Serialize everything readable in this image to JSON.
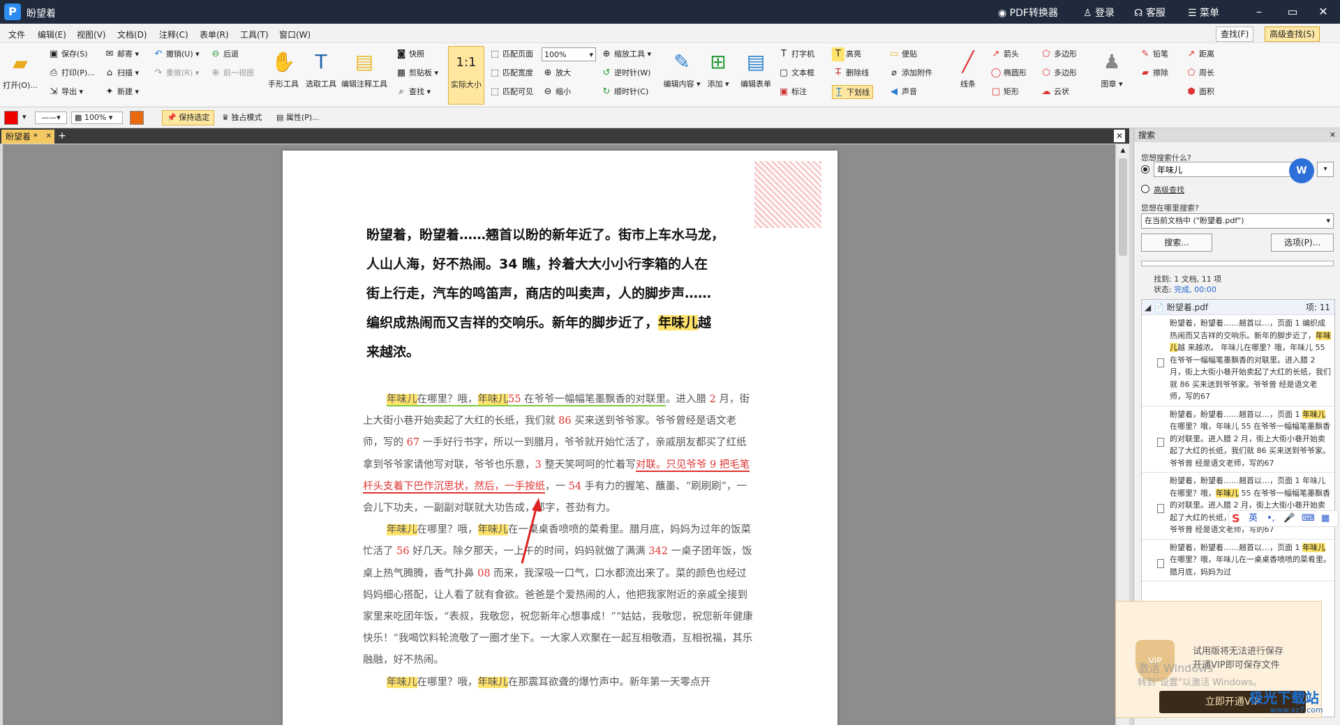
{
  "app": {
    "title": "盼望着",
    "pdf_converter": "PDF转换器",
    "login": "登录",
    "service": "客服",
    "menu": "菜单",
    "minimize": "–",
    "maximize": "▭",
    "close": "✕"
  },
  "menus": [
    "文件",
    "编辑(E)",
    "视图(V)",
    "文档(D)",
    "注释(C)",
    "表单(R)",
    "工具(T)",
    "窗口(W)"
  ],
  "menu_right": {
    "find": "查找(F)",
    "advanced_find": "高级查找(S)"
  },
  "ribbon": {
    "open": "打开(O)...",
    "save": "保存(S)",
    "mail": "邮寄",
    "undo": "撤销(U)",
    "back": "后退",
    "print": "打印(P)...",
    "scan": "扫描",
    "redo": "重做(R)",
    "prev_view": "前一视图",
    "export": "导出",
    "new": "新建",
    "hand": "手形工具",
    "select": "选取工具",
    "edit_annot": "编辑注释工具",
    "snapshot": "快照",
    "clipboard": "剪贴板",
    "search": "查找",
    "actual_size": "实际大小",
    "fit_page": "匹配页面",
    "fit_width": "匹配宽度",
    "fit_visible": "匹配可见",
    "zoom_value": "100%",
    "zoom_tool": "缩放工具",
    "zoom_in": "放大",
    "zoom_out": "缩小",
    "rotate_ccw": "逆时针(W)",
    "rotate_cw": "顺时针(C)",
    "edit_content": "编辑内容",
    "add": "添加",
    "edit_form": "编辑表单",
    "typewriter": "打字机",
    "textbox": "文本框",
    "callout": "标注",
    "highlight": "高亮",
    "strikeout": "删除线",
    "underline": "下划线",
    "note": "便贴",
    "attach": "添加附件",
    "sound": "声音",
    "line": "线条",
    "arrow": "箭头",
    "ellipse": "椭圆形",
    "rect": "矩形",
    "polygon": "多边形",
    "polyline": "多边形",
    "cloud": "云状",
    "stamp": "图章",
    "pencil": "铅笔",
    "eraser": "擦除",
    "distance": "距离",
    "perimeter": "周长",
    "area": "面积"
  },
  "fmtbar": {
    "opacity": "100%",
    "keep_select": "保持选定",
    "exclusive": "独占模式",
    "properties": "属性(P)..."
  },
  "tab": {
    "name": "盼望着 *"
  },
  "document": {
    "heading": [
      "盼望着，盼望着……翘首以盼的新年近了。街市上车水马龙，",
      "人山人海，好不热闹。34 瞧，拎着大大小小行李箱的人在",
      "街上行走，汽车的鸣笛声，商店的叫卖声，人的脚步声……",
      "编织成热闹而又吉祥的交响乐。新年的脚步近了，",
      "年味儿",
      "越",
      "来越浓。"
    ],
    "kw": "年味儿",
    "p1": [
      "在哪里？哦，",
      "55",
      " 在爷爷一幅幅笔墨飘香的对联里",
      "。进入腊 ",
      "2",
      " 月，街上大街小巷开始卖起了大红的长纸，我们就 ",
      "86",
      " 买来送到爷爷家。爷爷曾经是语文老师，写的 ",
      "67",
      " 一手好行书字，所以一到腊月，爷爷就开始忙活了，亲戚朋友都买了红纸拿到爷爷家请他写对联，爷爷也乐意，",
      "3",
      " 整天笑呵呵的忙着写",
      "对联。只见爷爷 9 把毛笔杆头支着下巴作沉思状，然后，一手按纸",
      "，一 ",
      "54",
      " 手有力的握笔、蘸墨、“刷刷刷”，一会儿下功夫，一副副对联就大功告成，那字，苍劲有力。"
    ],
    "p2": [
      "在哪里？哦，",
      "在一桌桌香喷喷的菜肴里。腊月底，妈妈为过年的饭菜忙活了 ",
      "56",
      " 好几天。除夕那天，一上午的时间，妈妈就做了满满 ",
      "342",
      " 一桌子团年饭，饭桌上热气腾腾，香气扑鼻 ",
      "08",
      " 而来，我深吸一口气，口水都流出来了。菜的颜色也经过妈妈细心搭配，让人看了就有食欲。爸爸是个爱热闹的人，他把我家附近的亲戚全接到家里来吃团年饭，“表叔，我敬您，祝您新年心想事成！”“姑姑，我敬您，祝您新年健康快乐！”我喝饮料轮流敬了一圈才坐下。一大家人欢聚在一起互相敬酒，互相祝福，其乐融融，好不热闹。"
    ],
    "p3": [
      "在哪里？哦，",
      "在那震耳欲聋的爆竹声中。新年第一天零点开"
    ]
  },
  "search_panel": {
    "title": "搜索",
    "q_label": "您想搜索什么?",
    "query": "年味儿",
    "advanced": "高级查找",
    "where_label": "您想在哪里搜索?",
    "where_value": "在当前文档中 (\"盼望着.pdf\")",
    "search_btn": "搜索...",
    "options_btn": "选项(P)...",
    "found": "找到: 1 文档, 11 项",
    "status_label": "状态: ",
    "status_value": "完成, 00:00",
    "file": "盼望着.pdf",
    "item_count": "项: 11",
    "results": [
      [
        "盼望着，盼望着……翘首以…，页面 1 编织成热闹而又吉祥的交响乐。新年的脚步近了，",
        "年味儿",
        "越 来越浓。 年味儿在哪里？哦，年味儿 55 在爷爷一幅幅笔墨飘香的对联里。进入腊 2 月，街上大街小巷开始卖起了大红的长纸，我们就 86 买来送到爷爷家。爷爷曾 经是语文老师，写的67"
      ],
      [
        "盼望着，盼望着……翘首以…，页面 1 ",
        "年味儿",
        "在哪里？哦，年味儿 55 在爷爷一幅幅笔墨飘香的对联里。进入腊 2 月，街上大街小巷开始卖起了大红的长纸，我们就 86 买来送到爷爷家。爷爷曾 经是语文老师，写的67"
      ],
      [
        "盼望着，盼望着……翘首以…，页面 1 年味儿在哪里？哦，",
        "年味儿",
        " 55 在爷爷一幅幅笔墨飘香的对联里。进入腊 2 月，街上大街小巷开始卖起了大红的长纸，我们就 86 买来送到爷爷家。爷爷曾 经是语文老师，写的67"
      ],
      [
        "盼望着，盼望着……翘首以…，页面 1 ",
        "年味儿",
        "在哪里？哦，年味儿在一桌桌香喷喷的菜肴里。腊月底，妈妈为过"
      ]
    ]
  },
  "vip": {
    "line1": "试用版将无法进行保存",
    "line2": "开通VIP即可保存文件",
    "button": "立即开通VIP",
    "badge": "VIP"
  },
  "watermark": {
    "line1": "激活 Windows",
    "line2": "转到\"设置\"以激活 Windows。"
  },
  "site": {
    "name": "极光下载站",
    "url": "www.xz7.com"
  },
  "ime": {
    "label": "英"
  }
}
